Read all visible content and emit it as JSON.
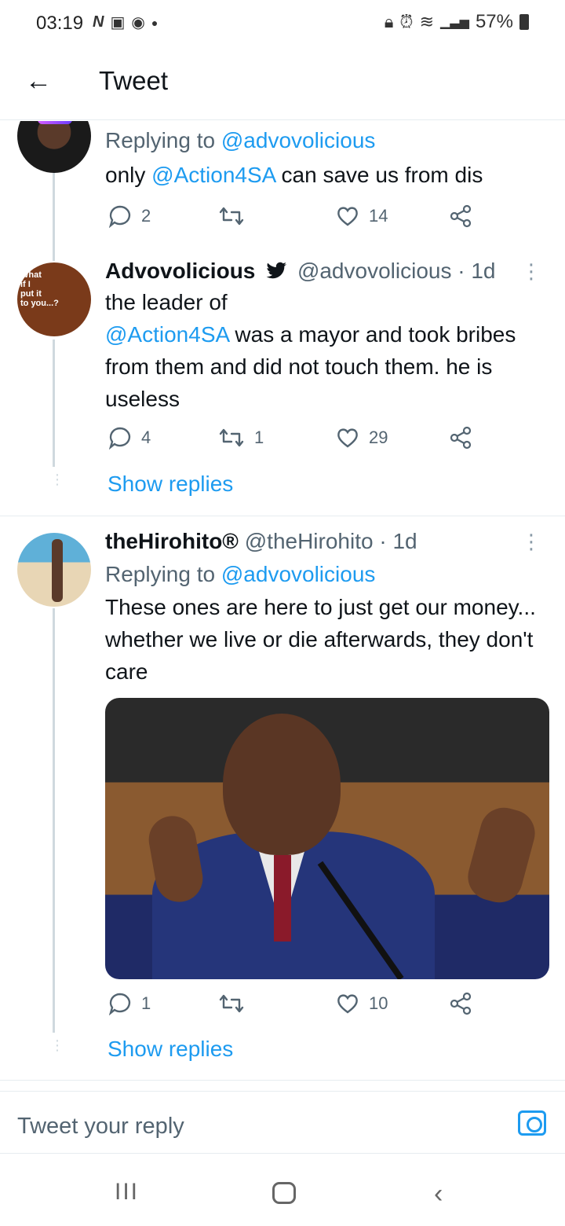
{
  "status_bar": {
    "time": "03:19",
    "battery": "57%",
    "icons_left": [
      "n-icon",
      "gallery-icon",
      "spotify-icon",
      "dot-icon"
    ],
    "icons_right": [
      "lock-icon",
      "alarm-icon",
      "wifi-icon",
      "signal-icon",
      "battery-icon"
    ]
  },
  "header": {
    "back_icon": "arrow-left-icon",
    "title": "Tweet"
  },
  "tweets": [
    {
      "reply_prefix": "Replying to ",
      "reply_to": "@advovolicious",
      "text_parts": [
        "only ",
        "@Action4SA",
        " can save us from dis"
      ],
      "replies": "2",
      "retweets": "",
      "likes": "14"
    },
    {
      "display_name": "Advovolicious",
      "handle": "@advovolicious",
      "time": "· 1d",
      "avatar_text": [
        "What",
        "if I",
        "put it",
        "to you...?"
      ],
      "text_line1": "the leader  of",
      "text_mention": "@Action4SA",
      "text_rest": " was a mayor and took bribes from them and did not touch them. he is useless",
      "replies": "4",
      "retweets": "1",
      "likes": "29",
      "show_replies": "Show replies"
    },
    {
      "display_name": "theHirohito®",
      "handle": "@theHirohito",
      "time": "· 1d",
      "reply_prefix": "Replying to ",
      "reply_to": "@advovolicious",
      "text": "These ones are here to just get our money... whether we live or die afterwards, they don't care",
      "replies": "1",
      "retweets": "",
      "likes": "10",
      "show_replies": "Show replies"
    }
  ],
  "composer": {
    "placeholder": "Tweet your reply"
  },
  "nav": {
    "recent": "III",
    "back": "‹"
  }
}
